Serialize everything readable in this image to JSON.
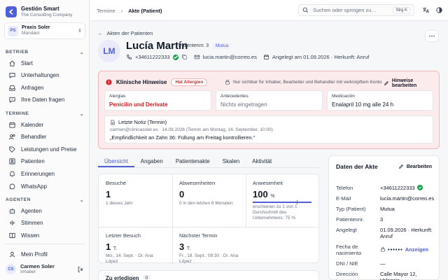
{
  "colors": {
    "accent": "#4f5fd8",
    "danger": "#d1262d",
    "success": "#16a34a"
  },
  "brand": {
    "name": "Gestión Smart",
    "sub": "The Consulting Company",
    "icon": "arrow-left-box-icon"
  },
  "practice": {
    "initials": "PS",
    "name": "Praxis Soler",
    "role": "Mandant"
  },
  "sidebar": {
    "betrieb_label": "BETRIEB",
    "betrieb_items": [
      {
        "label": "Start",
        "icon": "home-icon"
      },
      {
        "label": "Unterhaltungen",
        "icon": "chat-icon"
      },
      {
        "label": "Anfragen",
        "icon": "inbox-icon"
      },
      {
        "label": "Ihre Daten fragen",
        "icon": "message-question-icon"
      }
    ],
    "termine_label": "TERMINE",
    "termine_items": [
      {
        "label": "Kalender",
        "icon": "calendar-icon"
      },
      {
        "label": "Behandler",
        "icon": "users-icon"
      },
      {
        "label": "Leistungen und Preise",
        "icon": "tag-icon"
      },
      {
        "label": "Patienten",
        "icon": "patients-icon"
      },
      {
        "label": "Erinnerungen",
        "icon": "bell-icon"
      },
      {
        "label": "WhatsApp",
        "icon": "whatsapp-icon"
      }
    ],
    "agenten_label": "AGENTEN",
    "agenten_items": [
      {
        "label": "Agenten",
        "icon": "bot-icon"
      },
      {
        "label": "Stimmen",
        "icon": "waveform-icon"
      },
      {
        "label": "Wissen",
        "icon": "book-icon"
      }
    ],
    "profile_label": "Mein Profil",
    "user": {
      "initials": "CS",
      "name": "Carmen Soler",
      "role": "Inhaber"
    }
  },
  "topbar": {
    "crumb_parent": "Termine",
    "crumb_current": "Akte (Patient)",
    "search_placeholder": "Suchen oder springen zu…",
    "shortcut": "Strg K"
  },
  "patient": {
    "back_label": "Akten der Patienten",
    "initials": "LM",
    "name": "Lucía Martín",
    "number": "Patientennr. 3",
    "insurance": "Mutua",
    "phone": "+34611222333",
    "email": "lucia.martin@correo.es",
    "created": "Angelegt am 01.09.2026 · Herkunft: Anruf"
  },
  "clinical": {
    "title": "Klinische Hinweise",
    "allergy_tag": "Hat Allergien",
    "visibility_note": "Nur sichtbar für Inhaber, Bearbeiter und Behandler mit verknüpftem Konto",
    "edit_label": "Hinweise bearbeiten",
    "boxes": [
      {
        "label": "Alergias",
        "value": "Penicilin und Derivate"
      },
      {
        "label": "Antecedentes",
        "value": "Nichts eingetragen"
      },
      {
        "label": "Medicación",
        "value": "Enalapril 10 mg alle 24 h"
      }
    ],
    "note_title": "Letzte Notiz (Termin)",
    "note_meta": "carmen@clinicasoler.es · 14.09.2026 (Termin am Montag, 14. September, 10:00)",
    "note_text": "„Empfindlichkeit an Zahn 36: Füllung am Freitag kontrollieren.“"
  },
  "tabs": [
    "Übersicht",
    "Angaben",
    "Patientenakte",
    "Skalen",
    "Aktivität"
  ],
  "stats": {
    "visits": {
      "label": "Besuche",
      "value": "1",
      "sub": "1 dieses Jahr"
    },
    "absences": {
      "label": "Abwesenheiten",
      "value": "0",
      "sub": "0 in den letzten 6 Monaten"
    },
    "attendance": {
      "label": "Anwesenheit",
      "value": "100",
      "unit": "%",
      "percent": 100,
      "benchmark": 75,
      "sub": "erschienen zu 1 von 1 · Durchschnitt des Unternehmens: 75 %"
    },
    "last_visit": {
      "label": "Letzter Besuch",
      "value": "1",
      "unit": "T.",
      "sub": "Mo., 14. Sept. · Dr. Ana López"
    },
    "next_appt": {
      "label": "Nächster Termin",
      "value": "3",
      "unit": "T.",
      "sub": "Fr., 18. Sept., 09:30 · Dr. Ana López"
    }
  },
  "todo": {
    "title": "Zu erledigen",
    "count": "0"
  },
  "record": {
    "title": "Daten der Akte",
    "edit_label": "Bearbeiten",
    "rows": [
      {
        "k": "Telefon",
        "v": "+34611222333"
      },
      {
        "k": "E-Mail",
        "v": "lucia.martin@correo.es"
      },
      {
        "k": "Typ (Patient)",
        "v": "Mutua"
      },
      {
        "k": "Patientennr.",
        "v": "3"
      },
      {
        "k": "Angelegt",
        "v": "01.09.2026 · Herkunft: Anruf"
      },
      {
        "k": "Fecha de nacimiento",
        "v": "••••••",
        "link": "Anzeigen"
      },
      {
        "k": "DNI / NIE",
        "v": "—"
      },
      {
        "k": "Dirección",
        "v": "Calle Mayor 12, Valencia"
      }
    ]
  }
}
